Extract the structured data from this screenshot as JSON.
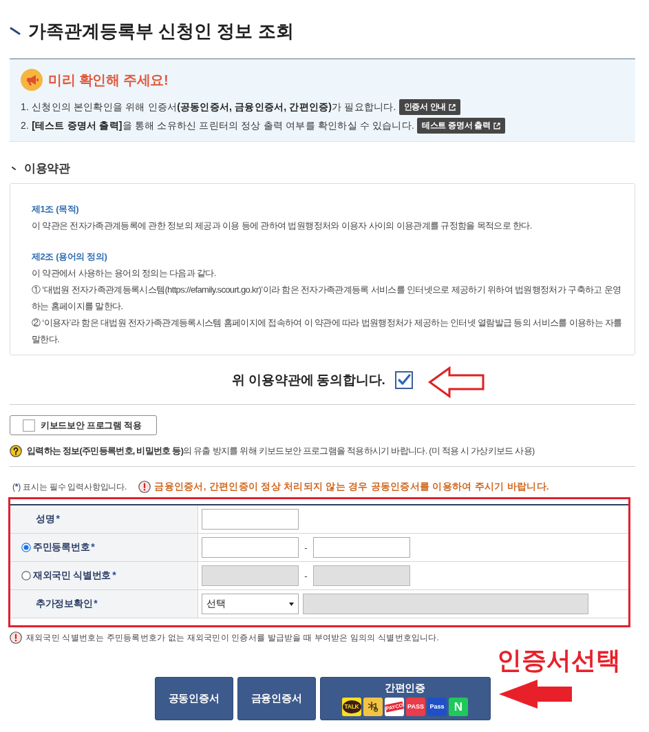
{
  "page": {
    "title": "가족관계등록부 신청인 정보 조회"
  },
  "notice": {
    "heading": "미리 확인해 주세요!",
    "items": [
      {
        "text": "1. 신청인의 본인확인을 위해 인증서**(공동인증서, 금융인증서, 간편인증)**가 필요합니다.",
        "button": "인증서 안내"
      },
      {
        "text": "2. **[테스트 증명서 출력]**을 통해 소유하신 프린터의 정상 출력 여부를 확인하실 수 있습니다.",
        "button": "테스트 증명서 출력"
      }
    ]
  },
  "terms": {
    "heading": "이용약관",
    "articles": [
      {
        "title": "제1조 (목적)",
        "paragraphs": [
          "이 약관은 전자가족관계등록에 관한 정보의 제공과 이용 등에 관하여 법원행정처와 이용자 사이의 이용관계를 규정함을 목적으로 한다."
        ]
      },
      {
        "title": "제2조 (용어의 정의)",
        "paragraphs": [
          "이 약관에서 사용하는 용어의 정의는 다음과 같다.",
          "① ‘대법원 전자가족관계등록시스템(https://efamily.scourt.go.kr)’이라 함은 전자가족관계등록 서비스를 인터넷으로 제공하기 위하여 법원행정처가 구축하고 운영하는 홈페이지를 말한다.",
          "② ‘이용자’라 함은 대법원 전자가족관계등록시스템 홈페이지에 접속하여 이 약관에 따라 법원행정처가 제공하는 인터넷 열람발급 등의 서비스를 이용하는 자를 말한다."
        ]
      }
    ]
  },
  "agreement": {
    "label": "위 이용약관에 동의합니다.",
    "checked": true
  },
  "keyboard_security": {
    "label": "키보드보안 프로그램 적용",
    "checked": false,
    "hint": "**입력하는 정보(주민등록번호, 비밀번호 등)**의 유출 방지를 위해 키보드보안 프로그램을 적용하시기 바랍니다. (미 적용 시 가상키보드 사용)"
  },
  "form": {
    "required_note": {
      "open": "(",
      "mark": "*",
      "rest": ") 표시는 필수 입력사항입니다."
    },
    "warning": "금융인증서, 간편인증이 정상 처리되지 않는 경우 공동인증서를 이용하여 주시기 바랍니다.",
    "rows": [
      {
        "kind": "text",
        "label": "성명",
        "mark": "*",
        "disabled": false
      },
      {
        "kind": "radio",
        "label": "주민등록번호",
        "mark": "*",
        "selected": true,
        "disabled": false,
        "separator": "-"
      },
      {
        "kind": "radio",
        "label": "재외국민 식별번호",
        "mark": "*",
        "selected": false,
        "disabled": true,
        "separator": "-"
      },
      {
        "kind": "select",
        "label": "추가정보확인",
        "mark": "*",
        "value": "선택",
        "disabled": true
      }
    ],
    "footnote": "재외국민 식별번호는 주민등록번호가 없는 재외국민이 인증서를 발급받을 때 부여받은 임의의 식별번호입니다."
  },
  "auth_buttons": [
    {
      "kind": "plain",
      "label": "공동인증서"
    },
    {
      "kind": "plain",
      "label": "금융인증서"
    },
    {
      "kind": "simple",
      "label": "간편인증",
      "providers": [
        {
          "kind": "bubble",
          "label": "TALK",
          "color": "#f9df1d"
        },
        {
          "kind": "symbol",
          "color": "#f3c444"
        },
        {
          "kind": "banner",
          "label": "PAYCO",
          "color": "#ffffff"
        },
        {
          "kind": "text",
          "label": "PASS",
          "color": "#ea3c4c"
        },
        {
          "kind": "text",
          "label": "Pass",
          "color": "#2050c8"
        },
        {
          "kind": "text",
          "label": "N",
          "color": "#1fc85a"
        }
      ]
    }
  ],
  "annotation": {
    "text": "인증서선택"
  }
}
